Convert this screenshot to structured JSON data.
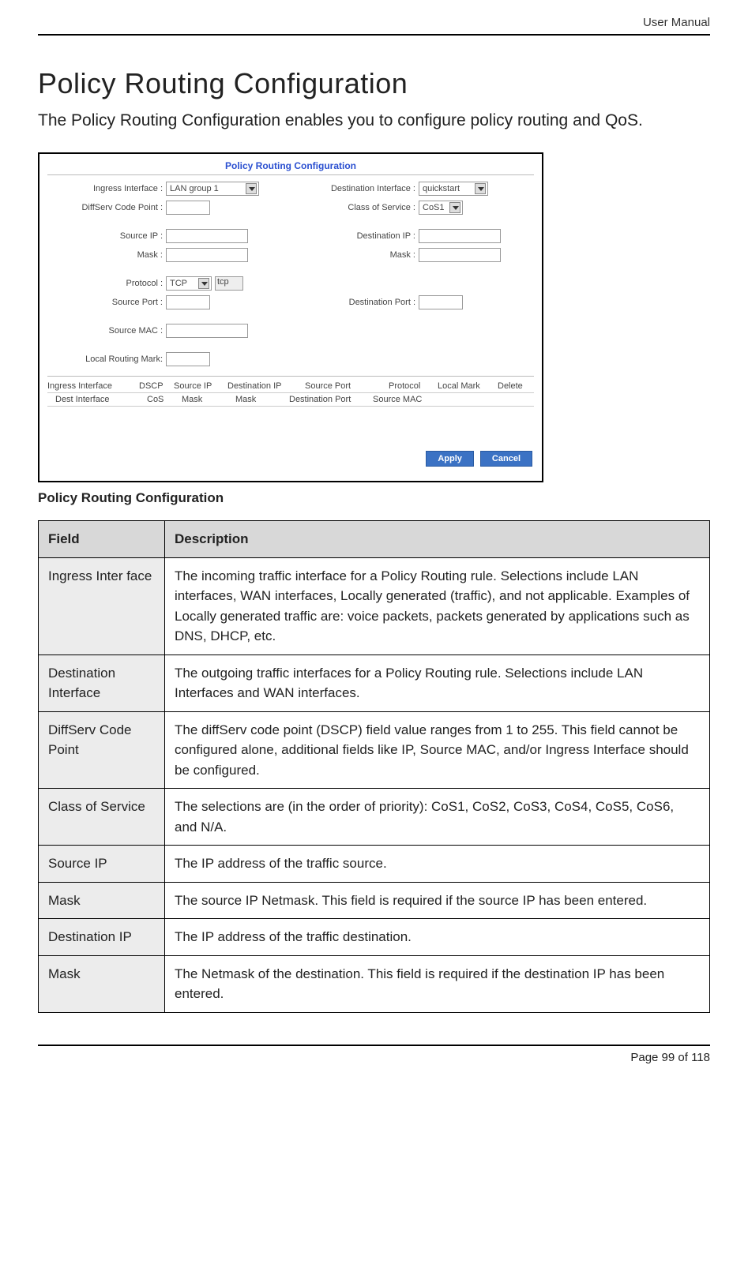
{
  "header": {
    "doc_label": "User Manual"
  },
  "title": "Policy Routing Configuration",
  "intro": "The Policy Routing Configuration enables you to configure policy routing and QoS.",
  "screenshot": {
    "panel_title": "Policy Routing Configuration",
    "labels": {
      "ingress_if": "Ingress Interface :",
      "dest_if": "Destination Interface :",
      "dscp": "DiffServ Code Point :",
      "cos": "Class of Service :",
      "src_ip": "Source IP :",
      "dst_ip": "Destination IP :",
      "mask": "Mask :",
      "protocol": "Protocol :",
      "src_port": "Source Port :",
      "dst_port": "Destination Port :",
      "src_mac": "Source MAC :",
      "local_mark": "Local Routing Mark:"
    },
    "values": {
      "ingress_if": "LAN group 1",
      "dest_if": "quickstart",
      "cos": "CoS1",
      "protocol": "TCP",
      "protocol_ro": "tcp"
    },
    "headers_row1": [
      "Ingress Interface",
      "DSCP",
      "Source IP",
      "Destination IP",
      "Source Port",
      "Protocol",
      "Local Mark",
      "Delete"
    ],
    "headers_row2": [
      "Dest Interface",
      "CoS",
      "Mask",
      "Mask",
      "Destination Port",
      "Source MAC"
    ],
    "buttons": {
      "apply": "Apply",
      "cancel": "Cancel"
    }
  },
  "caption": "Policy Routing Configuration",
  "table": {
    "head_field": "Field",
    "head_desc": "Description",
    "rows": [
      {
        "field": "Ingress Inter face",
        "desc": "The incoming traffic interface for a Policy Routing rule. Selections include LAN interfaces, WAN interfaces, Locally generated (traffic), and not applicable. Examples of Locally generated traffic are: voice packets, packets generated by applications such as DNS, DHCP, etc."
      },
      {
        "field": "Destination Interface",
        "desc": "The outgoing traffic interfaces for a Policy Routing rule. Selections include LAN Interfaces and WAN interfaces."
      },
      {
        "field": "DiffServ Code Point",
        "desc": "The diffServ code point (DSCP) field value ranges from 1 to 255. This field cannot be configured alone, additional fields like IP, Source MAC, and/or Ingress Interface should be configured."
      },
      {
        "field": "Class of Service",
        "desc": "The selections are (in the order of priority): CoS1, CoS2, CoS3, CoS4, CoS5, CoS6, and N/A."
      },
      {
        "field": "Source IP",
        "desc": "The IP address of the traffic source."
      },
      {
        "field": "Mask",
        "desc": "The source IP Netmask. This field is required if the source IP has been entered."
      },
      {
        "field": "Destination IP",
        "desc": "The IP address of the traffic destination."
      },
      {
        "field": "Mask",
        "desc": "The Netmask of the destination. This field is required if the destination IP has been entered."
      }
    ]
  },
  "footer": {
    "page_label": "Page 99 of 118"
  }
}
